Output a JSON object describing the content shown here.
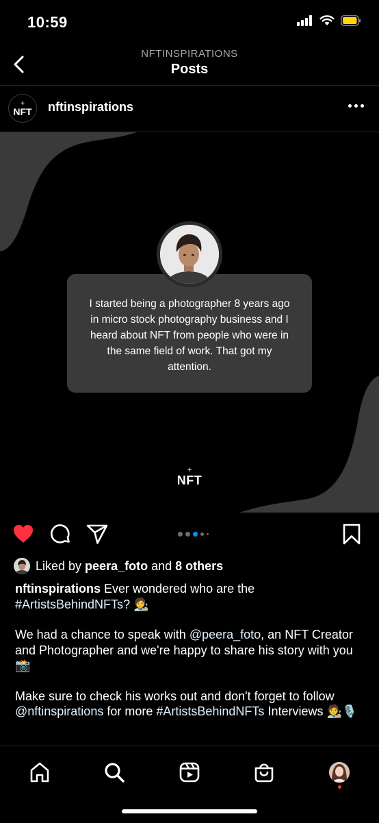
{
  "status_bar": {
    "time": "10:59",
    "icons": [
      "signal-icon",
      "wifi-icon",
      "battery-icon"
    ],
    "battery_color": "#ffd60a"
  },
  "header": {
    "subtitle": "NFTINSPIRATIONS",
    "title": "Posts",
    "back_icon": "chevron-left-icon"
  },
  "post": {
    "account": {
      "username": "nftinspirations",
      "avatar_text": "NFT",
      "avatar_spark": "+"
    },
    "image": {
      "quote": "I started being a photographer 8 years ago in micro stock photography business and I heard about NFT from people who were in the same field of work. That got my attention.",
      "logo_text": "NFT",
      "logo_spark": "+",
      "background_color": "#000000",
      "shape_color": "#3a3a3a",
      "card_color": "#3a3a3a"
    },
    "actions": {
      "like_icon": "heart-filled-icon",
      "like_color": "#ff3040",
      "comment_icon": "comment-icon",
      "share_icon": "send-icon",
      "save_icon": "bookmark-icon"
    },
    "carousel": {
      "total": 5,
      "active": 3,
      "active_color": "#0095f6"
    },
    "likes": {
      "prefix": "Liked by ",
      "user": "peera_foto",
      "and": " and ",
      "others": "8 others"
    },
    "caption": {
      "username": "nftinspirations",
      "line1": " Ever wondered who are the ",
      "hashtag1": "#ArtistsBehindNFTs",
      "line1_end": "? 🧑‍🎨",
      "p2_start": "We had a chance to speak with ",
      "mention1": "@peera_foto",
      "p2_end": ", an NFT Creator and Photographer and we're happy to share his story with you 📸",
      "p3_start": "Make sure to check his works out and don't forget to follow ",
      "mention2": "@nftinspirations",
      "p3_mid": " for more ",
      "hashtag2": "#ArtistsBehindNFTs",
      "p3_end": " Interviews 🧑‍🎨🎙️"
    }
  },
  "tab_bar": {
    "items": [
      "home-icon",
      "search-icon",
      "reels-icon",
      "shop-icon",
      "profile-avatar"
    ],
    "notification_color": "#ff3040"
  }
}
